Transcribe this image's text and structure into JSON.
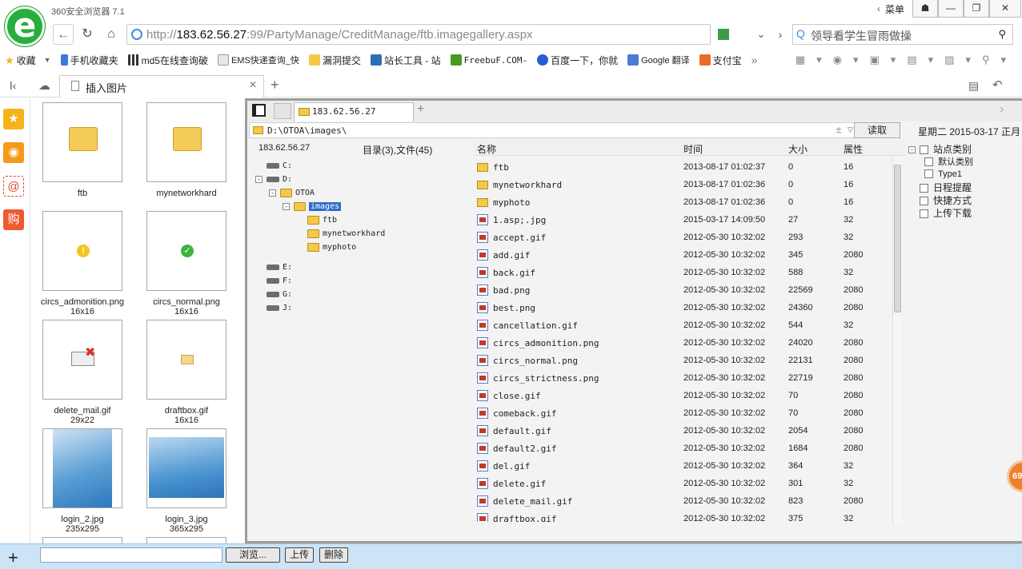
{
  "browser": {
    "title": "360安全浏览器 7.1",
    "menu_label": "菜单",
    "url_prefix": "http://",
    "url_host": "183.62.56.27",
    "url_rest": ":99/PartyManage/CreditManage/ftb.imagegallery.aspx",
    "search_placeholder": "领导看学生冒雨做操"
  },
  "bookmarks": [
    {
      "label": "收藏",
      "icon": "star-icon"
    },
    {
      "label": "手机收藏夹",
      "icon": "phone-icon"
    },
    {
      "label": "md5在线查询破",
      "icon": "grid-icon"
    },
    {
      "label": "EMS快递查询_快",
      "icon": "ems-icon"
    },
    {
      "label": "漏洞提交",
      "icon": "folder-icon"
    },
    {
      "label": "站长工具 - 站",
      "icon": "tool-icon"
    },
    {
      "label": "FreebuF.COM-",
      "icon": "freebuf-icon"
    },
    {
      "label": "百度一下，你就",
      "icon": "baidu-icon"
    },
    {
      "label": "Google 翻译",
      "icon": "translate-icon"
    },
    {
      "label": "支付宝",
      "icon": "alipay-icon"
    }
  ],
  "tab": {
    "label": "插入图片"
  },
  "thumbnails": [
    {
      "name": "ftb",
      "size": "",
      "kind": "folder"
    },
    {
      "name": "mynetworkhard",
      "size": "",
      "kind": "folder"
    },
    {
      "name": "circs_admonition.png",
      "size": "16x16",
      "kind": "warn"
    },
    {
      "name": "circs_normal.png",
      "size": "16x16",
      "kind": "ok"
    },
    {
      "name": "delete_mail.gif",
      "size": "29x22",
      "kind": "mail"
    },
    {
      "name": "draftbox.gif",
      "size": "16x16",
      "kind": "draft"
    },
    {
      "name": "login_2.jpg",
      "size": "235x295",
      "kind": "photo"
    },
    {
      "name": "login_3.jpg",
      "size": "365x295",
      "kind": "photo2"
    }
  ],
  "filemanager": {
    "tab_label": "183.62.56.27",
    "path": "D:\\OTOA\\images\\",
    "read_button": "读取",
    "date_text": "星期二 2015-03-17 正月",
    "tree_host": "183.62.56.27",
    "dir_summary": "目录(3),文件(45)",
    "columns": {
      "name": "名称",
      "time": "时间",
      "size": "大小",
      "attr": "属性"
    },
    "tree": [
      {
        "label": "C:",
        "type": "drive",
        "depth": 0,
        "exp": ""
      },
      {
        "label": "D:",
        "type": "drive",
        "depth": 0,
        "exp": "-"
      },
      {
        "label": "OTOA",
        "type": "folder",
        "depth": 1,
        "exp": "-"
      },
      {
        "label": "images",
        "type": "folder",
        "depth": 2,
        "exp": "-",
        "selected": true
      },
      {
        "label": "ftb",
        "type": "folder",
        "depth": 3,
        "exp": ""
      },
      {
        "label": "mynetworkhard",
        "type": "folder",
        "depth": 3,
        "exp": ""
      },
      {
        "label": "myphoto",
        "type": "folder",
        "depth": 3,
        "exp": ""
      },
      {
        "label": "E:",
        "type": "drive",
        "depth": 0,
        "exp": "",
        "gap": true
      },
      {
        "label": "F:",
        "type": "drive",
        "depth": 0,
        "exp": ""
      },
      {
        "label": "G:",
        "type": "drive",
        "depth": 0,
        "exp": ""
      },
      {
        "label": "J:",
        "type": "drive",
        "depth": 0,
        "exp": ""
      }
    ],
    "files": [
      {
        "name": "ftb",
        "time": "2013-08-17 01:02:37",
        "size": "0",
        "attr": "16",
        "folder": true
      },
      {
        "name": "mynetworkhard",
        "time": "2013-08-17 01:02:36",
        "size": "0",
        "attr": "16",
        "folder": true
      },
      {
        "name": "myphoto",
        "time": "2013-08-17 01:02:36",
        "size": "0",
        "attr": "16",
        "folder": true
      },
      {
        "name": "1.asp;.jpg",
        "time": "2015-03-17 14:09:50",
        "size": "27",
        "attr": "32"
      },
      {
        "name": "accept.gif",
        "time": "2012-05-30 10:32:02",
        "size": "293",
        "attr": "32"
      },
      {
        "name": "add.gif",
        "time": "2012-05-30 10:32:02",
        "size": "345",
        "attr": "2080"
      },
      {
        "name": "back.gif",
        "time": "2012-05-30 10:32:02",
        "size": "588",
        "attr": "32"
      },
      {
        "name": "bad.png",
        "time": "2012-05-30 10:32:02",
        "size": "22569",
        "attr": "2080"
      },
      {
        "name": "best.png",
        "time": "2012-05-30 10:32:02",
        "size": "24360",
        "attr": "2080"
      },
      {
        "name": "cancellation.gif",
        "time": "2012-05-30 10:32:02",
        "size": "544",
        "attr": "32"
      },
      {
        "name": "circs_admonition.png",
        "time": "2012-05-30 10:32:02",
        "size": "24020",
        "attr": "2080"
      },
      {
        "name": "circs_normal.png",
        "time": "2012-05-30 10:32:02",
        "size": "22131",
        "attr": "2080"
      },
      {
        "name": "circs_strictness.png",
        "time": "2012-05-30 10:32:02",
        "size": "22719",
        "attr": "2080"
      },
      {
        "name": "close.gif",
        "time": "2012-05-30 10:32:02",
        "size": "70",
        "attr": "2080"
      },
      {
        "name": "comeback.gif",
        "time": "2012-05-30 10:32:02",
        "size": "70",
        "attr": "2080"
      },
      {
        "name": "default.gif",
        "time": "2012-05-30 10:32:02",
        "size": "2054",
        "attr": "2080"
      },
      {
        "name": "default2.gif",
        "time": "2012-05-30 10:32:02",
        "size": "1684",
        "attr": "2080"
      },
      {
        "name": "del.gif",
        "time": "2012-05-30 10:32:02",
        "size": "364",
        "attr": "32"
      },
      {
        "name": "delete.gif",
        "time": "2012-05-30 10:32:02",
        "size": "301",
        "attr": "32"
      },
      {
        "name": "delete_mail.gif",
        "time": "2012-05-30 10:32:02",
        "size": "823",
        "attr": "2080"
      },
      {
        "name": "draftbox.gif",
        "time": "2012-05-30 10:32:02",
        "size": "375",
        "attr": "32"
      }
    ],
    "right_tree": [
      {
        "label": "站点类别",
        "exp": "-",
        "depth": 0
      },
      {
        "label": "默认类别",
        "exp": "",
        "depth": 1
      },
      {
        "label": "Type1",
        "exp": "",
        "depth": 1
      },
      {
        "label": "日程提醒",
        "exp": "",
        "depth": 0
      },
      {
        "label": "快捷方式",
        "exp": "",
        "depth": 0
      },
      {
        "label": "上传下载",
        "exp": "",
        "depth": 0
      }
    ]
  },
  "bottom": {
    "browse_label": "浏览...",
    "upload_label": "上传",
    "delete_label": "删除"
  },
  "float_ball": "69"
}
